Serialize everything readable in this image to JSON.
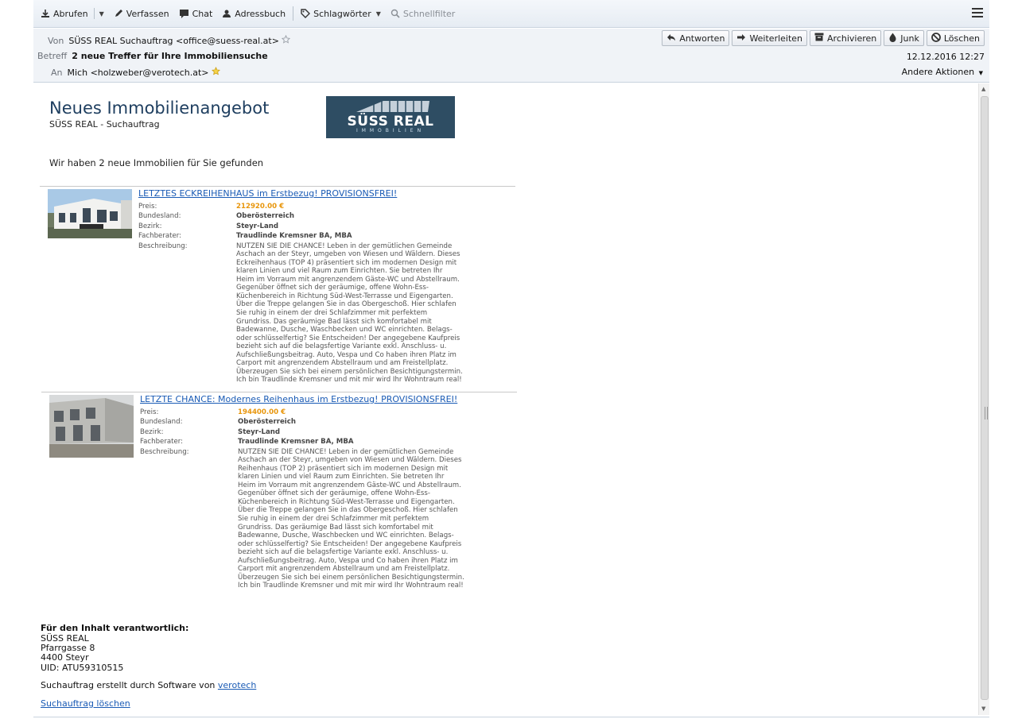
{
  "toolbar": {
    "items": [
      {
        "label": "Abrufen",
        "icon": "download-icon"
      },
      {
        "label": "Verfassen",
        "icon": "pencil-icon"
      },
      {
        "label": "Chat",
        "icon": "chat-icon"
      },
      {
        "label": "Adressbuch",
        "icon": "addressbook-icon"
      },
      {
        "label": "Schlagwörter",
        "icon": "tag-icon"
      },
      {
        "label": "Schnellfilter",
        "icon": "filter-icon"
      }
    ],
    "menu_icon": "hamburger-menu-icon"
  },
  "header": {
    "from_label": "Von",
    "from_value": "SÜSS REAL Suchauftrag <office@suess-real.at>",
    "subject_label": "Betreff",
    "subject_value": "2 neue Treffer für Ihre Immobiliensuche",
    "to_label": "An",
    "to_value": "Mich <holzweber@verotech.at>",
    "date": "12.12.2016 12:27",
    "more_actions": "Andere Aktionen",
    "actions": [
      {
        "label": "Antworten",
        "icon": "reply-icon"
      },
      {
        "label": "Weiterleiten",
        "icon": "forward-icon"
      },
      {
        "label": "Archivieren",
        "icon": "archive-icon"
      },
      {
        "label": "Junk",
        "icon": "junk-icon"
      },
      {
        "label": "Löschen",
        "icon": "delete-icon"
      }
    ]
  },
  "email": {
    "title": "Neues Immobilienangebot",
    "subtitle": "SÜSS REAL - Suchauftrag",
    "logo_main": "SÜSS REAL",
    "logo_sub": "IMMOBILIEN",
    "intro": "Wir haben 2 neue Immobilien für Sie gefunden",
    "field_labels": {
      "price": "Preis:",
      "state": "Bundesland:",
      "district": "Bezirk:",
      "advisor": "Fachberater:",
      "description": "Beschreibung:"
    },
    "listings": [
      {
        "title": "LETZTES ECKREIHENHAUS im Erstbezug! PROVISIONSFREI!",
        "price": "212920.00 €",
        "state": "Oberösterreich",
        "district": "Steyr-Land",
        "advisor": "Traudlinde Kremsner BA, MBA",
        "description_lines": [
          "NUTZEN SIE DIE CHANCE! Leben in der gemütlichen Gemeinde",
          "Aschach an der Steyr, umgeben von Wiesen und Wäldern. Dieses",
          "Eckreihenhaus (TOP 4) präsentiert sich im modernen Design mit",
          "klaren Linien und viel Raum zum Einrichten. Sie betreten Ihr",
          "Heim im Vorraum mit angrenzendem Gäste-WC und Abstellraum.",
          "Gegenüber öffnet sich der geräumige, offene Wohn-Ess-",
          "Küchenbereich in Richtung Süd-West-Terrasse und Eigengarten.",
          "Über die Treppe gelangen Sie in das Obergeschoß. Hier schlafen",
          "Sie ruhig in einem der drei Schlafzimmer mit perfektem",
          "Grundriss. Das geräumige Bad lässt sich komfortabel mit",
          "Badewanne, Dusche, Waschbecken und WC einrichten. Belags-",
          "oder schlüsselfertig? Sie Entscheiden! Der angegebene Kaufpreis",
          "bezieht sich auf die belagsfertige Variante exkl. Anschluss- u.",
          "Aufschließungsbeitrag. Auto, Vespa und Co haben ihren Platz im",
          "Carport mit angrenzendem Abstellraum und am Freistellplatz.",
          "Überzeugen Sie sich bei einem persönlichen Besichtigungstermin.",
          "Ich bin Traudlinde Kremsner und mit mir wird Ihr Wohntraum real!"
        ]
      },
      {
        "title": "LETZTE CHANCE: Modernes Reihenhaus im Erstbezug! PROVISIONSFREI!",
        "price": "194400.00 €",
        "state": "Oberösterreich",
        "district": "Steyr-Land",
        "advisor": "Traudlinde Kremsner BA, MBA",
        "description_lines": [
          "NUTZEN SIE DIE CHANCE! Leben in der gemütlichen Gemeinde",
          "Aschach an der Steyr, umgeben von Wiesen und Wäldern. Dieses",
          "Reihenhaus (TOP 2) präsentiert sich im modernen Design mit",
          "klaren Linien und viel Raum zum Einrichten. Sie betreten Ihr",
          "Heim im Vorraum mit angrenzendem Gäste-WC und Abstellraum.",
          "Gegenüber öffnet sich der geräumige, offene Wohn-Ess-",
          "Küchenbereich in Richtung Süd-West-Terrasse und Eigengarten.",
          "Über die Treppe gelangen Sie in das Obergeschoß. Hier schlafen",
          "Sie ruhig in einem der drei Schlafzimmer mit perfektem",
          "Grundriss. Das geräumige Bad lässt sich komfortabel mit",
          "Badewanne, Dusche, Waschbecken und WC einrichten. Belags-",
          "oder schlüsselfertig? Sie Entscheiden! Der angegebene Kaufpreis",
          "bezieht sich auf die belagsfertige Variante exkl. Anschluss- u.",
          "Aufschließungsbeitrag. Auto, Vespa und Co haben ihren Platz im",
          "Carport mit angrenzendem Abstellraum und am Freistellplatz.",
          "Überzeugen Sie sich bei einem persönlichen Besichtigungstermin.",
          "Ich bin Traudlinde Kremsner und mit mir wird Ihr Wohntraum real!"
        ]
      }
    ],
    "footer": {
      "heading": "Für den Inhalt verantwortlich:",
      "company": "SÜSS REAL",
      "street": "Pfarrgasse 8",
      "city": "4400 Steyr",
      "uid": "UID: ATU59310515",
      "software_prefix": "Suchauftrag erstellt durch Software von",
      "software_link": "verotech",
      "delete_link": "Suchauftrag löschen"
    }
  },
  "colors": {
    "accent_link": "#1a5bb5",
    "price": "#e8960c",
    "title": "#1f3f60",
    "logo_bg": "#2e4d63"
  }
}
